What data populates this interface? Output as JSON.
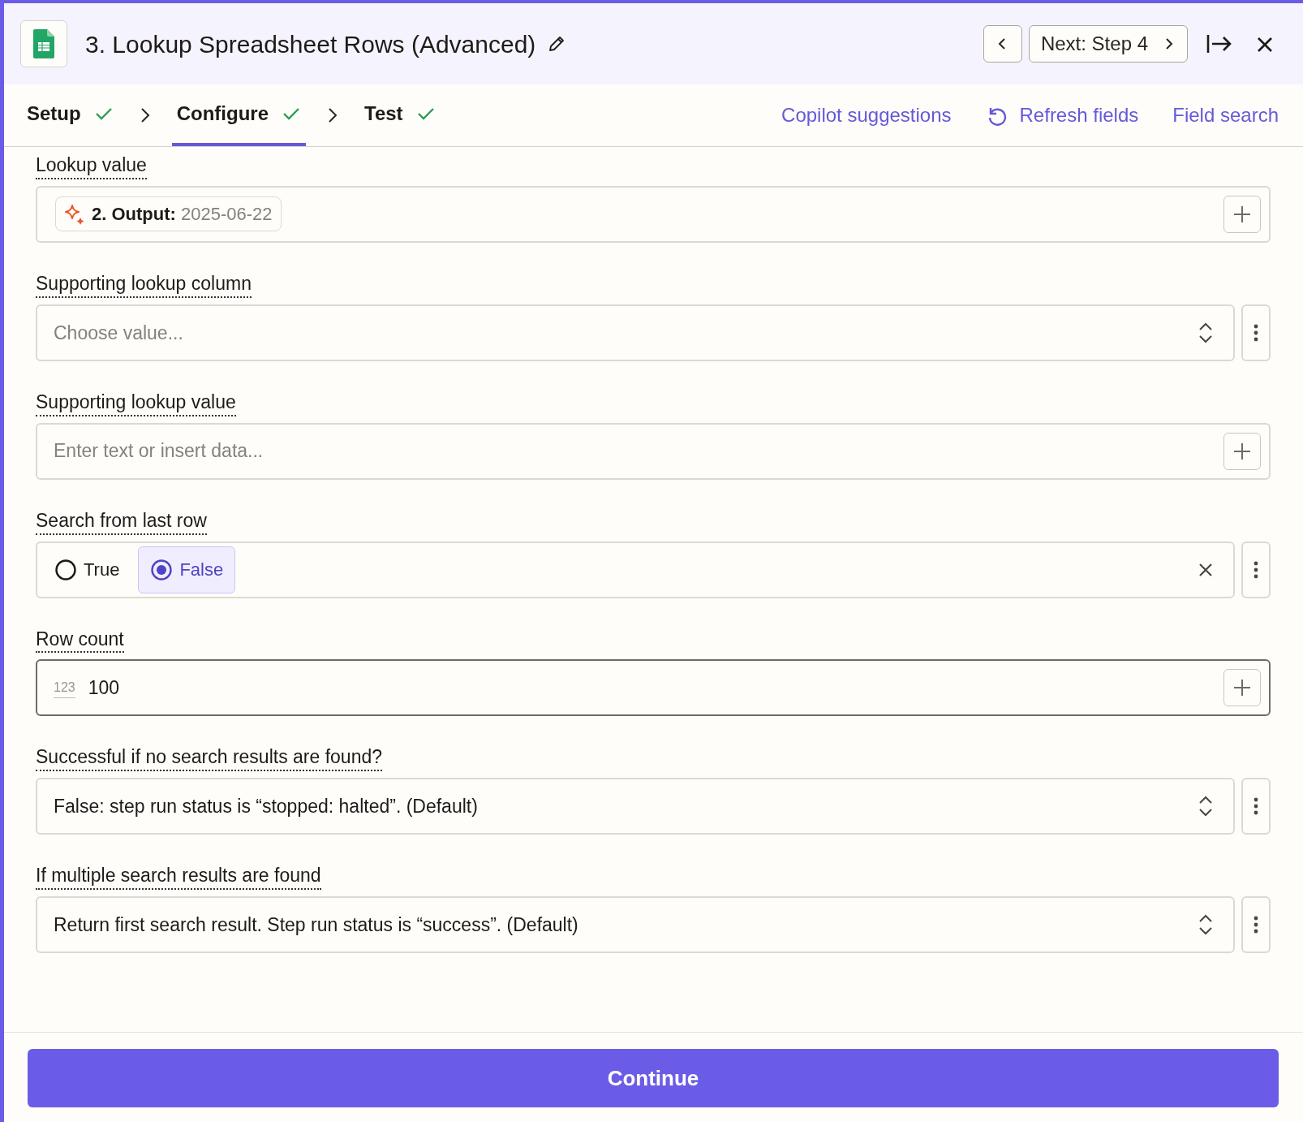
{
  "header": {
    "title": "3. Lookup Spreadsheet Rows (Advanced)",
    "next_button": "Next: Step 4"
  },
  "tabs": [
    {
      "label": "Setup",
      "done": true,
      "selected": false
    },
    {
      "label": "Configure",
      "done": true,
      "selected": true
    },
    {
      "label": "Test",
      "done": true,
      "selected": false
    }
  ],
  "links": [
    {
      "label": "Copilot suggestions",
      "kind": "plain"
    },
    {
      "label": "Refresh fields",
      "kind": "refresh"
    },
    {
      "label": "Field search",
      "kind": "plain"
    }
  ],
  "fields": [
    {
      "label": "Lookup value",
      "kind": "token",
      "token": {
        "step": "2. Output:",
        "value": "2025-06-22"
      },
      "control": {
        "kind": "plus"
      },
      "menu": false
    },
    {
      "label": "Supporting lookup column",
      "kind": "select",
      "placeholder": "Choose value...",
      "control": {
        "kind": "chevron"
      },
      "menu": true
    },
    {
      "label": "Supporting lookup value",
      "kind": "text",
      "placeholder": "Enter text or insert data...",
      "control": {
        "kind": "plus"
      },
      "menu": false
    },
    {
      "label": "Search from last row",
      "kind": "radio",
      "options": [
        {
          "label": "True",
          "selected": false
        },
        {
          "label": "False",
          "selected": true
        }
      ],
      "control": {
        "kind": "clear"
      },
      "menu": true
    },
    {
      "label": "Row count",
      "kind": "number",
      "type_hint": "123",
      "value": "100",
      "focused": true,
      "control": {
        "kind": "plus"
      },
      "menu": false
    },
    {
      "label": "Successful if no search results are found?",
      "kind": "select",
      "value": "False: step run status is “stopped: halted”. (Default)",
      "control": {
        "kind": "chevron"
      },
      "menu": true
    },
    {
      "label": "If multiple search results are found",
      "kind": "select",
      "value": "Return first search result. Step run status is “success”. (Default)",
      "control": {
        "kind": "chevron"
      },
      "menu": true
    }
  ],
  "continue_button": "Continue"
}
